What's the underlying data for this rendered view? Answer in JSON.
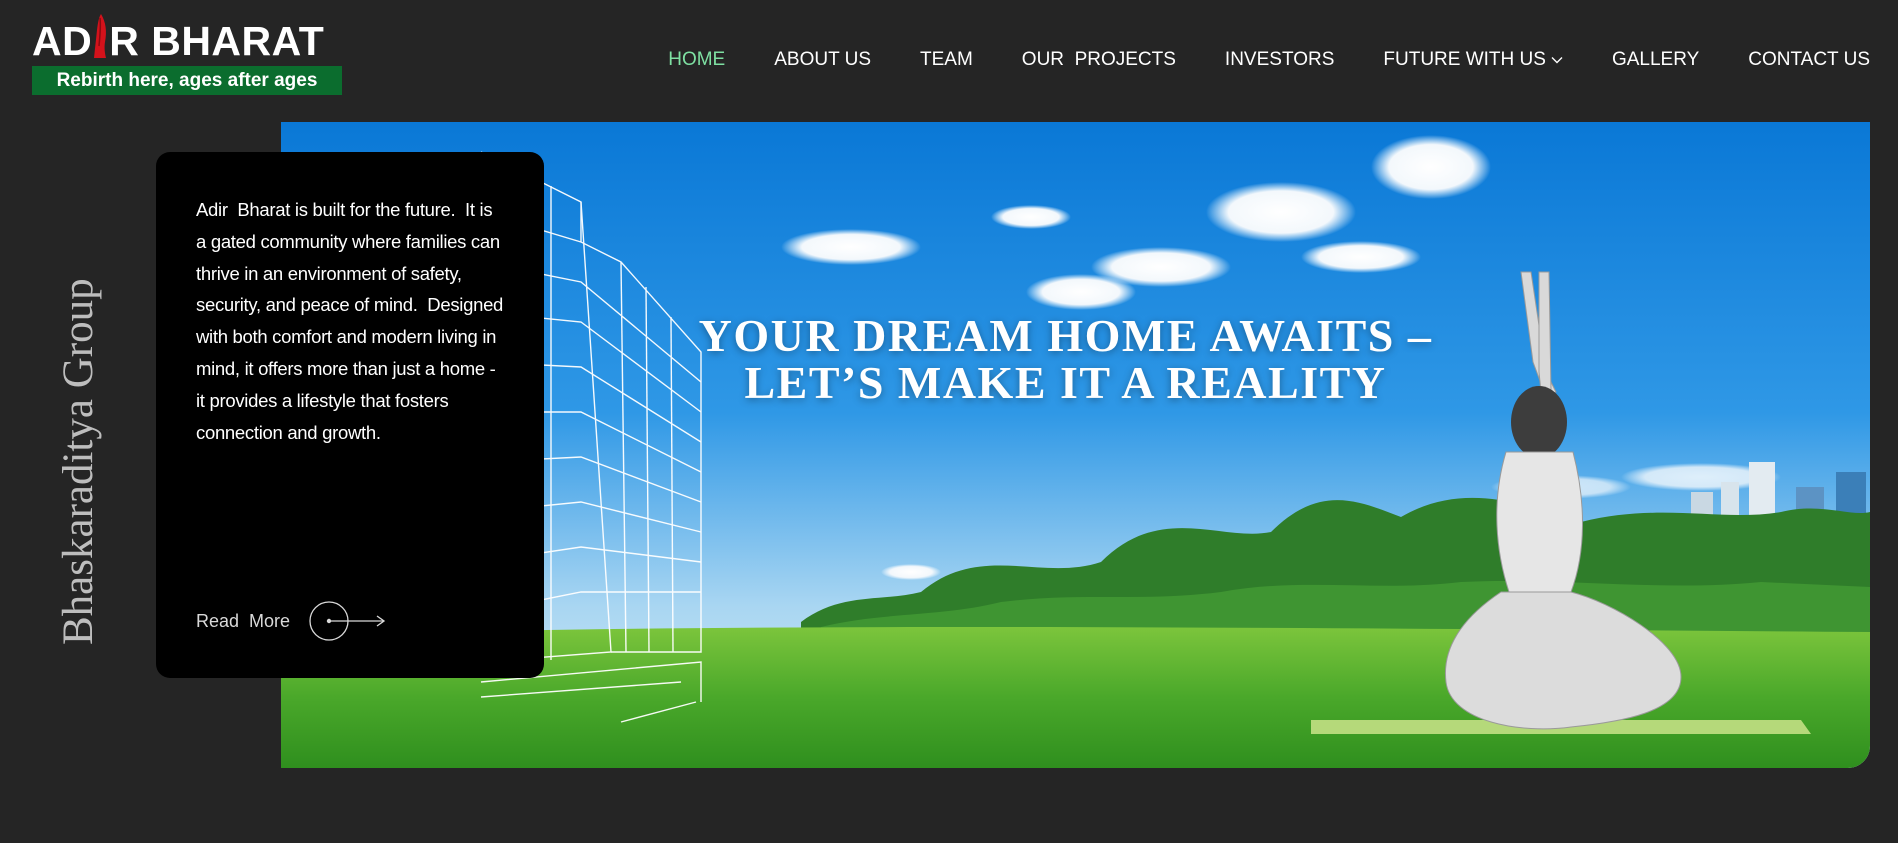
{
  "logo": {
    "title_pre": "AD",
    "title_post": "R BHARAT",
    "tagline": "Rebirth here, ages after ages",
    "colors": {
      "tagline_bg": "#0b6d2e",
      "mark": "#d3121b"
    }
  },
  "nav": {
    "items": [
      {
        "label": "HOME",
        "active": true
      },
      {
        "label": "ABOUT US"
      },
      {
        "label": "TEAM"
      },
      {
        "label": "OUR  PROJECTS"
      },
      {
        "label": "INVESTORS"
      },
      {
        "label": "FUTURE WITH US",
        "icon": "chevron-down-icon"
      },
      {
        "label": "GALLERY"
      },
      {
        "label": "CONTACT US"
      }
    ],
    "active_color": "#7ee0a2"
  },
  "side_brand": "Bhaskaraditya Group",
  "hero": {
    "heading_line1": "YOUR DREAM HOME AWAITS –",
    "heading_line2": "LET’S MAKE IT A REALITY"
  },
  "info_card": {
    "text": "Adir  Bharat is built for the future.  It is a gated community where families can thrive in an environment of safety, security, and peace of mind.  Designed with both comfort and modern living in mind, it offers more than just a home - it provides a lifestyle that fosters connection and growth.",
    "read_more": "Read  More",
    "read_more_icon": "arrow-right-circle-icon"
  }
}
